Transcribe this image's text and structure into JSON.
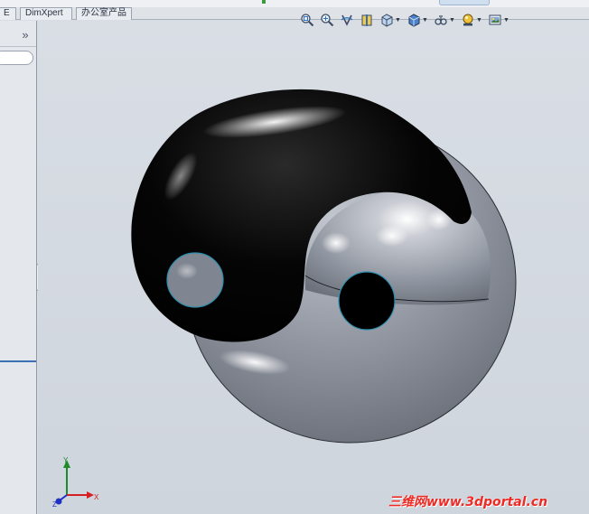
{
  "tabs": [
    {
      "label": "E"
    },
    {
      "label": "DimXpert"
    },
    {
      "label": "办公室产品"
    }
  ],
  "left_panel": {
    "expand_glyph": "»",
    "handle_glyph": "‹ ‹ ‹"
  },
  "hud_toolbar": {
    "buttons": [
      {
        "icon": "zoom-to-fit-icon"
      },
      {
        "icon": "zoom-to-area-icon"
      },
      {
        "icon": "previous-view-icon"
      },
      {
        "icon": "section-view-icon"
      },
      {
        "icon": "view-orientation-icon",
        "dropdown": true
      },
      {
        "icon": "display-style-icon",
        "dropdown": true
      },
      {
        "icon": "hide-show-items-icon",
        "dropdown": true
      },
      {
        "icon": "edit-appearance-icon",
        "dropdown": true
      },
      {
        "icon": "apply-scene-icon",
        "dropdown": true
      }
    ],
    "dropdown_glyph": "▼"
  },
  "triad": {
    "x_label": "X",
    "y_label": "Y",
    "z_label": "Z",
    "colors": {
      "x": "#d42020",
      "y": "#1f8a2a",
      "z": "#2030c0"
    }
  },
  "watermark": {
    "text": "三维网www.3dportal.cn",
    "color": "#ee2a24"
  },
  "colors": {
    "viewport_bg": "#d3d8df",
    "model_dark": "#000000",
    "model_light": "#8e949f",
    "edge_highlight": "#2f8fb0"
  }
}
